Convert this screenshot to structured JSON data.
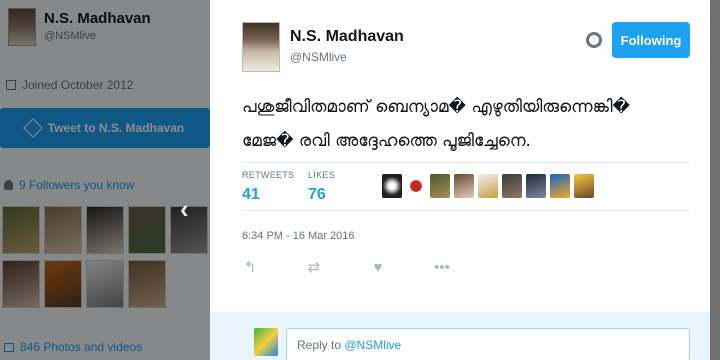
{
  "profile": {
    "name": "N.S. Madhavan",
    "handle": "@NSMlive",
    "joined": "Joined October 2012",
    "tweet_to_label": "Tweet to N.S. Madhavan",
    "followers_you_know": "9 Followers you know",
    "photos_videos": "846 Photos and videos"
  },
  "tweet": {
    "author_name": "N.S. Madhavan",
    "author_handle": "@NSMlive",
    "follow_label": "Following",
    "text_line1": "പശുജീവിതമാണ് ബെന്യാമ� എഴുതിയിരുന്നെങ്കി�",
    "text_line2": "മേജ� രവി അദ്ദേഹത്തെ പൂജിച്ചേനെ.",
    "retweets_label": "RETWEETS",
    "retweets_value": "41",
    "likes_label": "LIKES",
    "likes_value": "76",
    "timestamp": "6:34 PM - 16 Mar 2016"
  },
  "reply": {
    "prefix": "Reply to ",
    "mention": "@NSMlive"
  },
  "icons": {
    "reply": "reply-icon",
    "retweet": "retweet-icon",
    "like": "heart-icon",
    "more": "more-icon",
    "settings": "gear-icon",
    "nav": "chevron-left-icon"
  },
  "colors": {
    "accent": "#1da1f2",
    "muted": "#657786"
  }
}
